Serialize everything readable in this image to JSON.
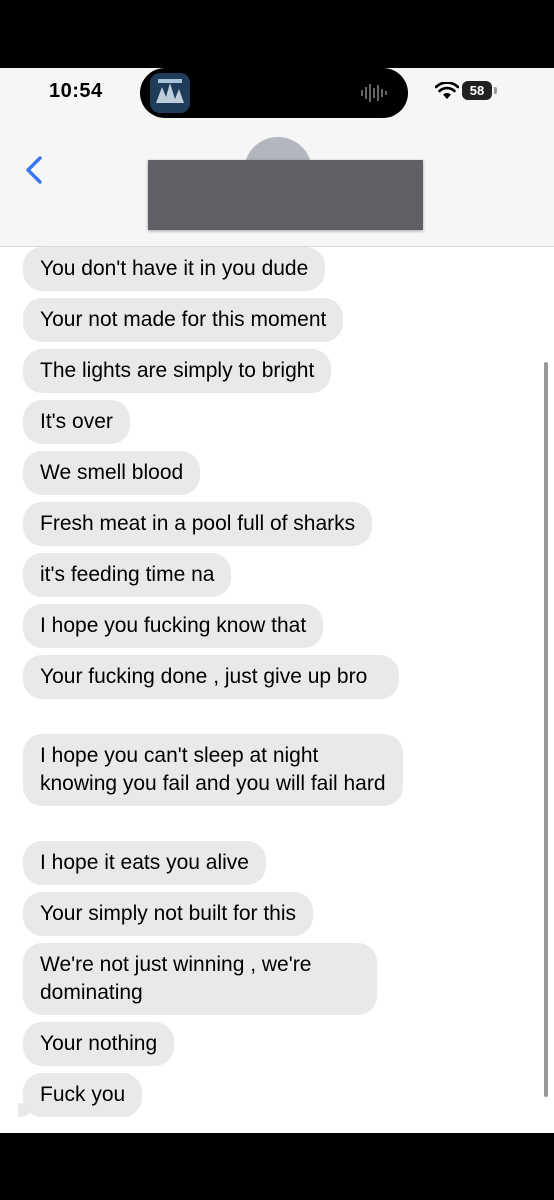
{
  "status_bar": {
    "time": "10:54",
    "battery_level": "58",
    "signal_icon": "waveform-icon",
    "wifi_icon": "wifi-icon"
  },
  "header": {
    "back_icon": "chevron-left-icon",
    "accent_color": "#3478f6"
  },
  "messages": [
    "You don't have it in you dude",
    "Your not made for this moment",
    "The lights are simply to bright",
    "It's over",
    "We smell blood",
    "Fresh meat in a pool full of sharks",
    "it's feeding time na",
    "I hope you fucking know that",
    "Your fucking done , just give up bro",
    "I hope you can't sleep at night knowing you fail and you will fail hard",
    "I hope it eats you alive",
    "Your simply not built for this",
    "We're not just winning , we're dominating",
    "Your nothing",
    "Fuck you"
  ],
  "colors": {
    "bubble_gray": "#e9e9eb",
    "header_bg": "#f6f6f7"
  }
}
